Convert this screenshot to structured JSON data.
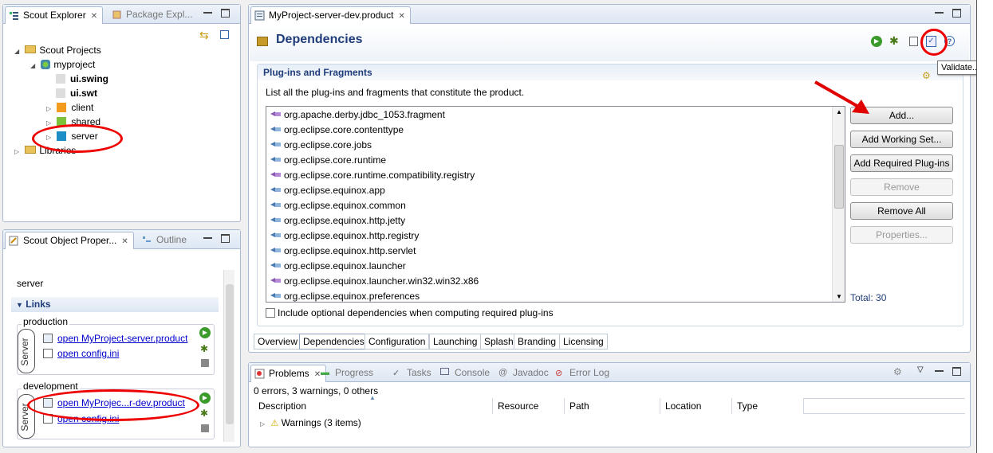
{
  "explorer": {
    "tabs": [
      "Scout Explorer",
      "Package Expl..."
    ],
    "tree": {
      "root": "Scout Projects",
      "project": "myproject",
      "children": [
        "ui.swing",
        "ui.swt",
        "client",
        "shared",
        "server"
      ],
      "libraries": "Libraries"
    }
  },
  "properties": {
    "tabs": [
      "Scout Object Proper...",
      "Outline"
    ],
    "title": "server",
    "section": "Links",
    "production": {
      "label": "production",
      "side": "Server",
      "links": [
        "open MyProject-server.product",
        "open config.ini"
      ]
    },
    "development": {
      "label": "development",
      "side": "Server",
      "links": [
        "open MyProjec...r-dev.product",
        "open config.ini"
      ]
    }
  },
  "editor": {
    "tab": "MyProject-server-dev.product",
    "title": "Dependencies",
    "tooltip": "Validate...",
    "section_title": "Plug-ins and Fragments",
    "description": "List all the plug-ins and fragments that constitute the product.",
    "plugins": [
      "org.apache.derby.jdbc_1053.fragment",
      "org.eclipse.core.contenttype",
      "org.eclipse.core.jobs",
      "org.eclipse.core.runtime",
      "org.eclipse.core.runtime.compatibility.registry",
      "org.eclipse.equinox.app",
      "org.eclipse.equinox.common",
      "org.eclipse.equinox.http.jetty",
      "org.eclipse.equinox.http.registry",
      "org.eclipse.equinox.http.servlet",
      "org.eclipse.equinox.launcher",
      "org.eclipse.equinox.launcher.win32.win32.x86",
      "org.eclipse.equinox.preferences"
    ],
    "buttons": {
      "add": "Add...",
      "add_working_set": "Add Working Set...",
      "add_required": "Add Required Plug-ins",
      "remove": "Remove",
      "remove_all": "Remove All",
      "properties": "Properties..."
    },
    "total": "Total: 30",
    "checkbox_label": "Include optional dependencies when computing required plug-ins",
    "page_tabs": [
      "Overview",
      "Dependencies",
      "Configuration",
      "Launching",
      "Splash",
      "Branding",
      "Licensing"
    ]
  },
  "problems": {
    "tabs": [
      "Problems",
      "Progress",
      "Tasks",
      "Console",
      "Javadoc",
      "Error Log"
    ],
    "summary": "0 errors, 3 warnings, 0 others",
    "columns": [
      "Description",
      "Resource",
      "Path",
      "Location",
      "Type"
    ],
    "row": "Warnings (3 items)"
  },
  "colors": {
    "accent": "#1f3d7a",
    "annotation": "#e00000",
    "link": "#0000cc"
  }
}
